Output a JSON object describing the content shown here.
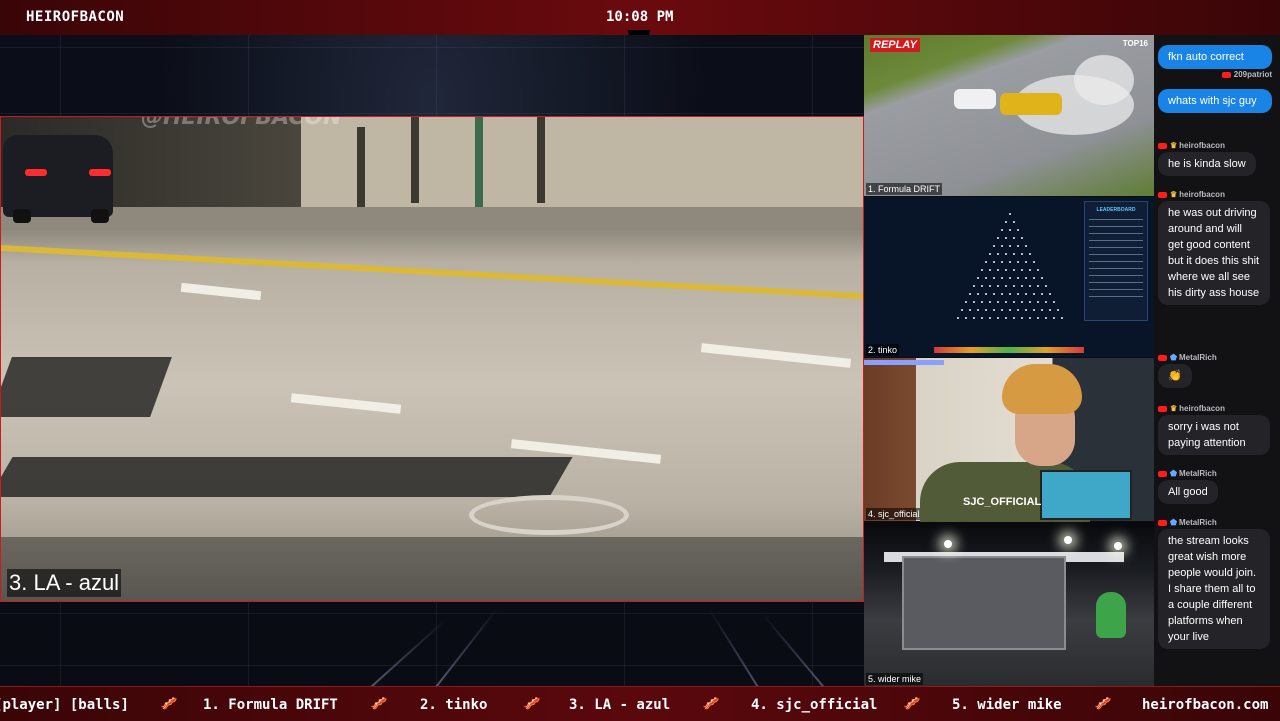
{
  "header": {
    "brand": "HEIROFBACON",
    "clock": "10:08 PM"
  },
  "main_video": {
    "label": "3. LA - azul",
    "watermark": "@HEIROFBACON"
  },
  "tiles": [
    {
      "label": "1. Formula DRIFT",
      "badge": "REPLAY",
      "corner": "TOP16"
    },
    {
      "label": "2. tinko",
      "board_title": "LEADERBOARD"
    },
    {
      "label": "4. sjc_official",
      "overlay": "SJC_OFFICIAL"
    },
    {
      "label": "5. wider mike"
    }
  ],
  "chat": {
    "messages": [
      {
        "type": "self",
        "text": "fkn auto correct",
        "author": "209patriot"
      },
      {
        "type": "self",
        "text": "whats with sjc guy"
      },
      {
        "type": "other",
        "author": "heirofbacon",
        "badge": "crown",
        "text": "he is kinda slow"
      },
      {
        "type": "other",
        "author": "heirofbacon",
        "badge": "crown",
        "text": "he was out driving around and will get good content but it does this shit where we all see his dirty ass house"
      },
      {
        "type": "other",
        "author": "MetalRich",
        "badge": "shield",
        "text": "👏"
      },
      {
        "type": "other",
        "author": "heirofbacon",
        "badge": "crown",
        "text": "sorry i was not paying attention"
      },
      {
        "type": "other",
        "author": "MetalRich",
        "badge": "shield",
        "text": "All good"
      },
      {
        "type": "other",
        "author": "MetalRich",
        "badge": "shield",
        "text": "the stream looks great wish more people would join. I share them all to a couple different platforms when your live"
      }
    ]
  },
  "ticker": {
    "items": [
      "player] [balls]",
      "1. Formula DRIFT",
      "2. tinko",
      "3. LA - azul",
      "4. sjc_official",
      "5. wider mike",
      "heirofbacon.com"
    ],
    "separator_icon": "bacon-icon"
  },
  "colors": {
    "frame_red": "#d01820",
    "bar_dark_red": "#5a080c",
    "chat_self_blue": "#1a84e6"
  }
}
